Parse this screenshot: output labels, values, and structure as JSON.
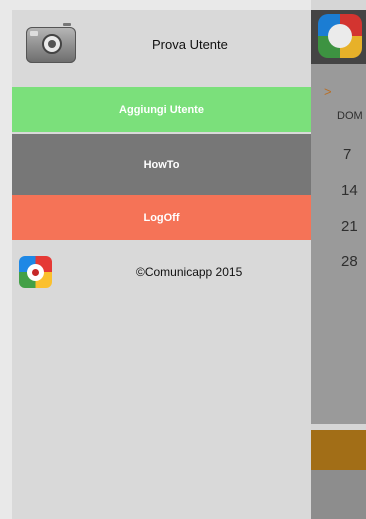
{
  "drawer": {
    "user_name": "Prova Utente",
    "menu": {
      "add_user": "Aggiungi Utente",
      "howto": "HowTo",
      "logoff": "LogOff"
    },
    "footer": {
      "copyright": "©Comunicapp 2015"
    }
  },
  "background": {
    "nav_arrow": ">",
    "weekday": "DOM",
    "days": [
      "7",
      "14",
      "21",
      "28"
    ]
  },
  "icons": {
    "camera": "camera-icon",
    "logo": "comunicapp-logo-icon"
  },
  "colors": {
    "add_user": "#7be07b",
    "howto": "#777777",
    "logoff": "#f57357",
    "drawer": "#d9d9d9"
  }
}
